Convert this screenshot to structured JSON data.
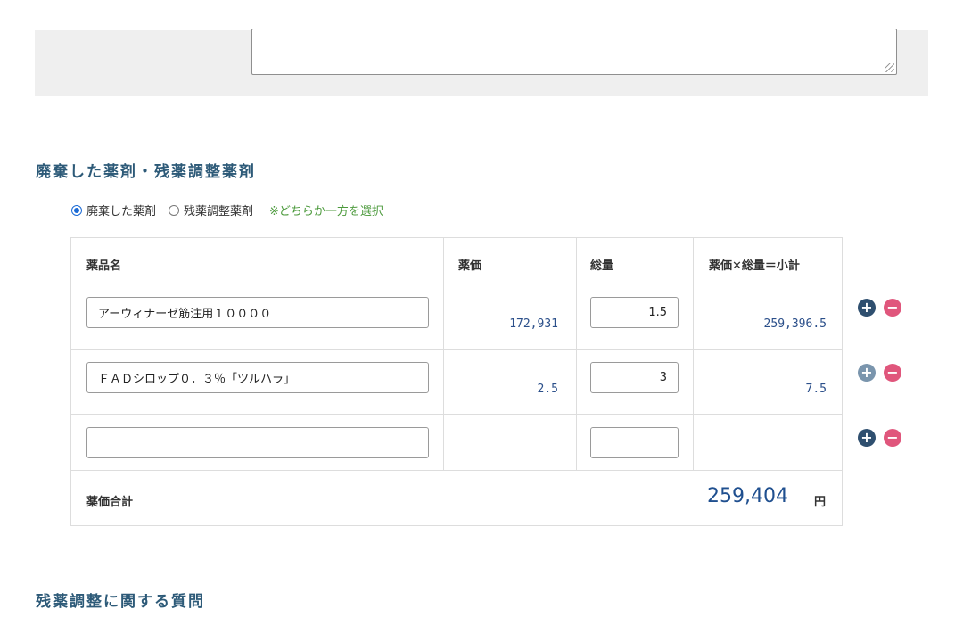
{
  "section1": {
    "title": "廃棄した薬剤・残薬調整薬剤"
  },
  "radio": {
    "option1": "廃棄した薬剤",
    "option2": "残薬調整薬剤",
    "selected": "option1",
    "note": "※どちらか一方を選択"
  },
  "table": {
    "headers": {
      "name": "薬品名",
      "price": "薬価",
      "quantity": "総量",
      "subtotal": "薬価✕総量＝小計"
    },
    "rows": [
      {
        "name": "アーウィナーゼ筋注用１００００",
        "price": "172,931",
        "quantity": "1.5",
        "subtotal": "259,396.5"
      },
      {
        "name": "ＦＡＤシロップ０．３％「ツルハラ」",
        "price": "2.5",
        "quantity": "3",
        "subtotal": "7.5"
      },
      {
        "name": "",
        "price": "",
        "quantity": "",
        "subtotal": ""
      }
    ],
    "total": {
      "label": "薬価合計",
      "value": "259,404",
      "unit": "円"
    }
  },
  "buttons": {
    "add": "+",
    "remove": "−"
  },
  "section2": {
    "title": "残薬調整に関する質問"
  }
}
